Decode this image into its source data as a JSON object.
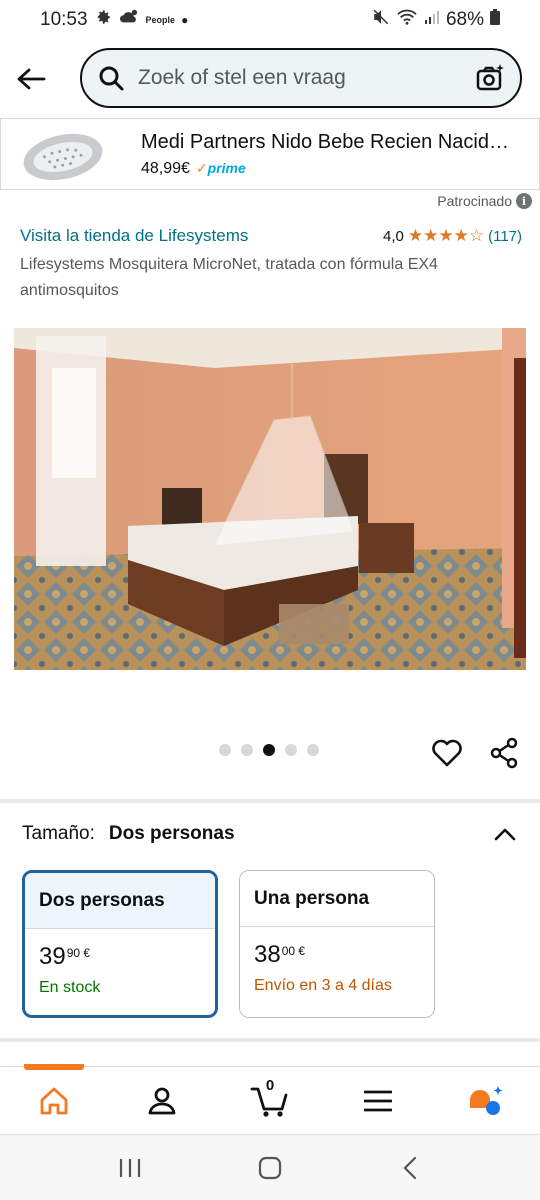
{
  "status_bar": {
    "time": "10:53",
    "app_label": "People",
    "battery": "68%"
  },
  "search": {
    "placeholder": "Zoek of stel een vraag"
  },
  "sponsored_ad": {
    "title": "Medi Partners Nido Bebe Recien Nacid…",
    "price": "48,99€",
    "prime_label": "prime",
    "sponsored_label": "Patrocinado",
    "info_glyph": "i"
  },
  "product": {
    "store_link": "Visita la tienda de Lifesystems",
    "rating_value": "4,0",
    "stars_display": "★★★★☆",
    "rating_count": "(117)",
    "title": "Lifesystems Mosquitera MicroNet, tratada con fórmula EX4 antimosquitos",
    "image_count": 5,
    "active_image_index": 2
  },
  "size_selector": {
    "label": "Tamaño:",
    "selected_value": "Dos personas",
    "options": [
      {
        "name": "Dos personas",
        "price_whole": "39",
        "price_fraction": "90 €",
        "status": "En stock",
        "selected": true
      },
      {
        "name": "Una persona",
        "price_whole": "38",
        "price_fraction": "00 €",
        "status": "Envío en 3 a 4 días",
        "selected": false
      }
    ]
  },
  "bottom_nav": {
    "cart_count": "0",
    "active_item": "home",
    "accent_color": "#f47921"
  },
  "colors": {
    "link": "#007185",
    "star": "#de7921",
    "selected_border": "#2162a1",
    "in_stock": "#007600",
    "delivery": "#c45500"
  }
}
